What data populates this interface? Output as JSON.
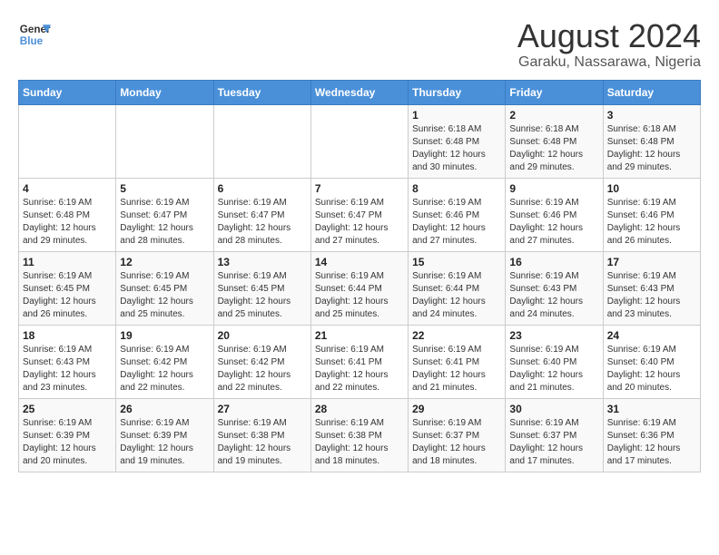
{
  "logo": {
    "line1": "General",
    "line2": "Blue"
  },
  "title": "August 2024",
  "subtitle": "Garaku, Nassarawa, Nigeria",
  "days_header": [
    "Sunday",
    "Monday",
    "Tuesday",
    "Wednesday",
    "Thursday",
    "Friday",
    "Saturday"
  ],
  "weeks": [
    [
      {
        "day": "",
        "info": ""
      },
      {
        "day": "",
        "info": ""
      },
      {
        "day": "",
        "info": ""
      },
      {
        "day": "",
        "info": ""
      },
      {
        "day": "1",
        "info": "Sunrise: 6:18 AM\nSunset: 6:48 PM\nDaylight: 12 hours\nand 30 minutes."
      },
      {
        "day": "2",
        "info": "Sunrise: 6:18 AM\nSunset: 6:48 PM\nDaylight: 12 hours\nand 29 minutes."
      },
      {
        "day": "3",
        "info": "Sunrise: 6:18 AM\nSunset: 6:48 PM\nDaylight: 12 hours\nand 29 minutes."
      }
    ],
    [
      {
        "day": "4",
        "info": "Sunrise: 6:19 AM\nSunset: 6:48 PM\nDaylight: 12 hours\nand 29 minutes."
      },
      {
        "day": "5",
        "info": "Sunrise: 6:19 AM\nSunset: 6:47 PM\nDaylight: 12 hours\nand 28 minutes."
      },
      {
        "day": "6",
        "info": "Sunrise: 6:19 AM\nSunset: 6:47 PM\nDaylight: 12 hours\nand 28 minutes."
      },
      {
        "day": "7",
        "info": "Sunrise: 6:19 AM\nSunset: 6:47 PM\nDaylight: 12 hours\nand 27 minutes."
      },
      {
        "day": "8",
        "info": "Sunrise: 6:19 AM\nSunset: 6:46 PM\nDaylight: 12 hours\nand 27 minutes."
      },
      {
        "day": "9",
        "info": "Sunrise: 6:19 AM\nSunset: 6:46 PM\nDaylight: 12 hours\nand 27 minutes."
      },
      {
        "day": "10",
        "info": "Sunrise: 6:19 AM\nSunset: 6:46 PM\nDaylight: 12 hours\nand 26 minutes."
      }
    ],
    [
      {
        "day": "11",
        "info": "Sunrise: 6:19 AM\nSunset: 6:45 PM\nDaylight: 12 hours\nand 26 minutes."
      },
      {
        "day": "12",
        "info": "Sunrise: 6:19 AM\nSunset: 6:45 PM\nDaylight: 12 hours\nand 25 minutes."
      },
      {
        "day": "13",
        "info": "Sunrise: 6:19 AM\nSunset: 6:45 PM\nDaylight: 12 hours\nand 25 minutes."
      },
      {
        "day": "14",
        "info": "Sunrise: 6:19 AM\nSunset: 6:44 PM\nDaylight: 12 hours\nand 25 minutes."
      },
      {
        "day": "15",
        "info": "Sunrise: 6:19 AM\nSunset: 6:44 PM\nDaylight: 12 hours\nand 24 minutes."
      },
      {
        "day": "16",
        "info": "Sunrise: 6:19 AM\nSunset: 6:43 PM\nDaylight: 12 hours\nand 24 minutes."
      },
      {
        "day": "17",
        "info": "Sunrise: 6:19 AM\nSunset: 6:43 PM\nDaylight: 12 hours\nand 23 minutes."
      }
    ],
    [
      {
        "day": "18",
        "info": "Sunrise: 6:19 AM\nSunset: 6:43 PM\nDaylight: 12 hours\nand 23 minutes."
      },
      {
        "day": "19",
        "info": "Sunrise: 6:19 AM\nSunset: 6:42 PM\nDaylight: 12 hours\nand 22 minutes."
      },
      {
        "day": "20",
        "info": "Sunrise: 6:19 AM\nSunset: 6:42 PM\nDaylight: 12 hours\nand 22 minutes."
      },
      {
        "day": "21",
        "info": "Sunrise: 6:19 AM\nSunset: 6:41 PM\nDaylight: 12 hours\nand 22 minutes."
      },
      {
        "day": "22",
        "info": "Sunrise: 6:19 AM\nSunset: 6:41 PM\nDaylight: 12 hours\nand 21 minutes."
      },
      {
        "day": "23",
        "info": "Sunrise: 6:19 AM\nSunset: 6:40 PM\nDaylight: 12 hours\nand 21 minutes."
      },
      {
        "day": "24",
        "info": "Sunrise: 6:19 AM\nSunset: 6:40 PM\nDaylight: 12 hours\nand 20 minutes."
      }
    ],
    [
      {
        "day": "25",
        "info": "Sunrise: 6:19 AM\nSunset: 6:39 PM\nDaylight: 12 hours\nand 20 minutes."
      },
      {
        "day": "26",
        "info": "Sunrise: 6:19 AM\nSunset: 6:39 PM\nDaylight: 12 hours\nand 19 minutes."
      },
      {
        "day": "27",
        "info": "Sunrise: 6:19 AM\nSunset: 6:38 PM\nDaylight: 12 hours\nand 19 minutes."
      },
      {
        "day": "28",
        "info": "Sunrise: 6:19 AM\nSunset: 6:38 PM\nDaylight: 12 hours\nand 18 minutes."
      },
      {
        "day": "29",
        "info": "Sunrise: 6:19 AM\nSunset: 6:37 PM\nDaylight: 12 hours\nand 18 minutes."
      },
      {
        "day": "30",
        "info": "Sunrise: 6:19 AM\nSunset: 6:37 PM\nDaylight: 12 hours\nand 17 minutes."
      },
      {
        "day": "31",
        "info": "Sunrise: 6:19 AM\nSunset: 6:36 PM\nDaylight: 12 hours\nand 17 minutes."
      }
    ]
  ]
}
